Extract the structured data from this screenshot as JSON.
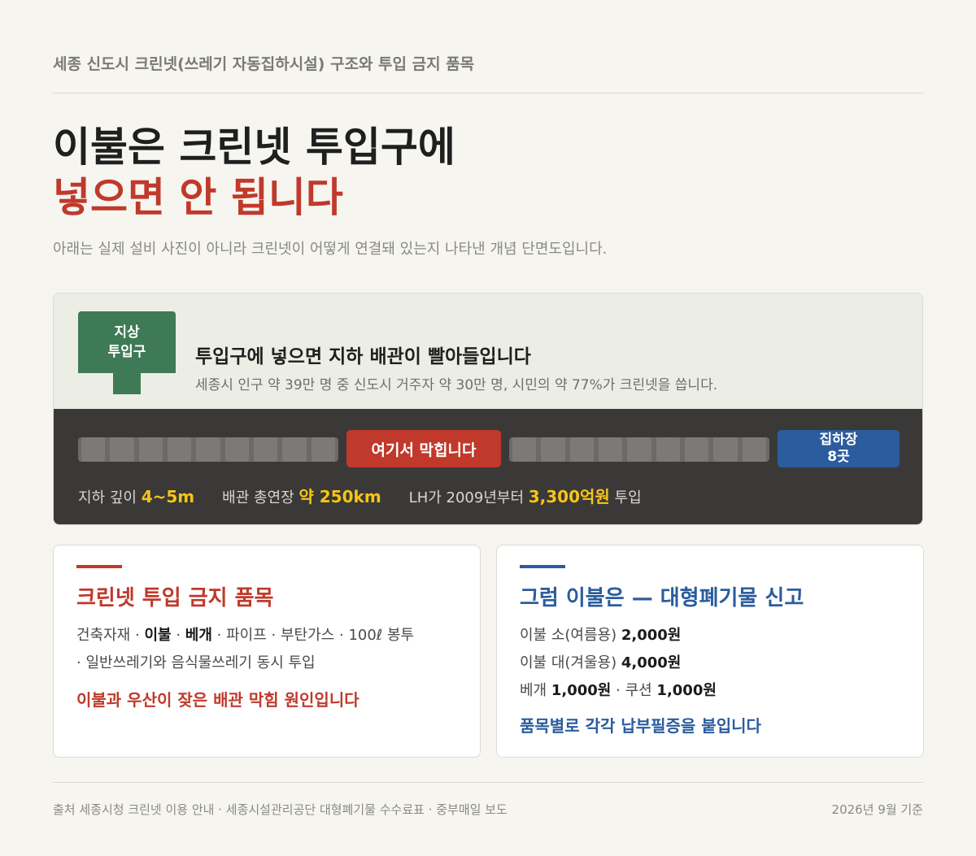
{
  "kicker": "세종 신도시 크린넷(쓰레기 자동집하시설) 구조와 투입 금지 품목",
  "headline": {
    "line1": "이불은 크린넷 투입구에",
    "line2": "넣으면 안 됩니다"
  },
  "subhead": "아래는 실제 설비 사진이 아니라 크린넷이 어떻게 연결돼 있는지 나타낸 개념 단면도입니다.",
  "diagram": {
    "inlet_label_1": "지상",
    "inlet_label_2": "투입구",
    "title": "투입구에 넣으면 지하 배관이 빨아들입니다",
    "description": "세종시 인구 약 39만 명 중 신도시 거주자 약 30만 명, 시민의 약 77%가 크린넷을 씁니다.",
    "blockage_label": "여기서 막힙니다",
    "station_label_1": "집하장",
    "station_label_2": "8곳",
    "stats": [
      {
        "label": "지하 깊이",
        "value": "4~5m",
        "suffix": ""
      },
      {
        "label": "배관 총연장",
        "value": "약 250km",
        "suffix": ""
      },
      {
        "label": "LH가 2009년부터",
        "value": "3,300억원",
        "suffix": "투입"
      }
    ]
  },
  "card_banned": {
    "title": "크린넷 투입 금지 품목",
    "item1": "건축자재",
    "sep": "·",
    "item2": "이불",
    "item3": "베개",
    "item4": "파이프",
    "item5": "부탄가스",
    "item6": "100ℓ 봉투",
    "item7": "일반쓰레기와 음식물쓰레기 동시 투입",
    "note": "이불과 우산이 잦은 배관 막힘 원인입니다"
  },
  "card_report": {
    "title": "그럼 이불은 — 대형폐기물 신고",
    "rows": [
      {
        "label": "이불 소(여름용)",
        "price": "2,000원"
      },
      {
        "label": "이불 대(겨울용)",
        "price": "4,000원"
      }
    ],
    "pillow_label": "베개",
    "pillow_price": "1,000원",
    "cushion_label": "쿠션",
    "cushion_price": "1,000원",
    "sep": "·",
    "note": "품목별로 각각 납부필증을 붙입니다"
  },
  "footer": {
    "source": "출처 세종시청 크린넷 이용 안내 · 세종시설관리공단 대형폐기물 수수료표 · 중부매일 보도",
    "date": "2026년 9월 기준"
  },
  "colors": {
    "accent_red": "#c0392b",
    "accent_blue": "#2b5c9e",
    "inlet_green": "#3f7a56",
    "highlight_yellow": "#f5c518",
    "underground_dark": "#3a3937"
  }
}
